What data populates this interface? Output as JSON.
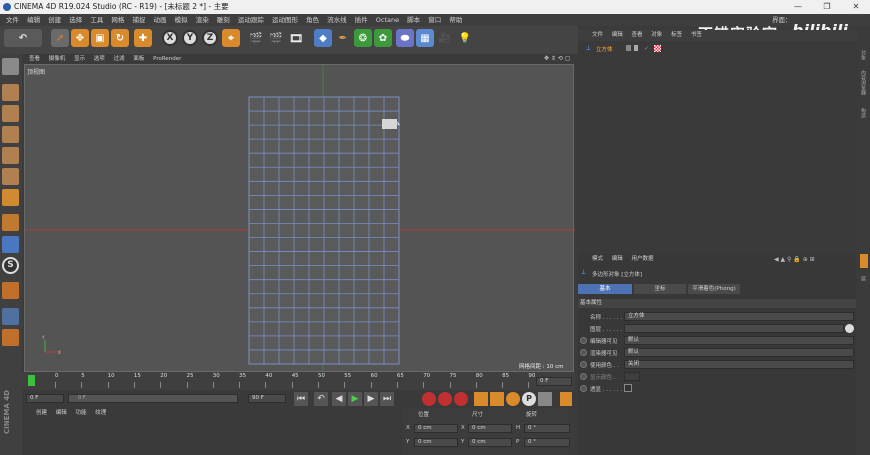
{
  "window": {
    "title": "CINEMA 4D R19.024 Studio (RC - R19) - [未标题 2 *] - 主要",
    "min": "—",
    "max": "❐",
    "close": "✕"
  },
  "menu": [
    "文件",
    "编辑",
    "创建",
    "选择",
    "工具",
    "网格",
    "捕捉",
    "动画",
    "模拟",
    "渲染",
    "雕刻",
    "运动跟踪",
    "运动图形",
    "角色",
    "流水线",
    "插件",
    "Octane",
    "脚本",
    "窗口",
    "帮助"
  ],
  "layout_label": "界面：",
  "watermark": {
    "text": "不错实验室",
    "logo": "bilibili"
  },
  "toolbar": {
    "x": "X",
    "y": "Y",
    "z": "Z"
  },
  "viewport": {
    "menu": [
      "查看",
      "摄像机",
      "显示",
      "选项",
      "过滤",
      "面板",
      "ProRender"
    ],
    "name": "顶视图",
    "grid_spacing": "网格间距 : 10 cm"
  },
  "timeline": {
    "ticks": [
      "0",
      "5",
      "10",
      "15",
      "20",
      "25",
      "30",
      "35",
      "40",
      "45",
      "50",
      "55",
      "60",
      "65",
      "70",
      "75",
      "80",
      "85",
      "90"
    ],
    "end_label": "0 F"
  },
  "playbar": {
    "start": "0 F",
    "range_start": "0 F",
    "range_end": "90 F",
    "end": "90 F"
  },
  "material_menu": [
    "创建",
    "编辑",
    "功能",
    "纹理"
  ],
  "coords": {
    "headers": [
      "位置",
      "尺寸",
      "旋转"
    ],
    "rows": [
      {
        "axis1": "X",
        "v1": "0 cm",
        "axis2": "X",
        "v2": "0 cm",
        "axis3": "H",
        "v3": "0 °"
      },
      {
        "axis1": "Y",
        "v1": "0 cm",
        "axis2": "Y",
        "v2": "0 cm",
        "axis3": "P",
        "v3": "0 °"
      }
    ]
  },
  "object_manager": {
    "menu": [
      "文件",
      "编辑",
      "查看",
      "对象",
      "标签",
      "书签"
    ],
    "object_name": "立方体"
  },
  "attributes": {
    "menu": [
      "模式",
      "编辑",
      "用户数据"
    ],
    "title": "多边形对象 [立方体]",
    "tabs": [
      "基本",
      "坐标",
      "平滑着色(Phong)"
    ],
    "section": "基本属性",
    "fields": [
      {
        "label": "名称 . . . . . .",
        "value": "立方体"
      },
      {
        "label": "图层 . . . . . .",
        "value": ""
      },
      {
        "label": "编辑器可见",
        "value": "默认"
      },
      {
        "label": "渲染器可见",
        "value": "默认"
      },
      {
        "label": "使用颜色 . .",
        "value": "关闭"
      },
      {
        "label": "显示颜色 . .",
        "value": ""
      },
      {
        "label": "透显 . . . . . .",
        "value": ""
      }
    ]
  },
  "side_tabs": [
    "对象",
    "内容浏览器",
    "构造",
    "层"
  ],
  "brand_vertical": "CINEMA 4D"
}
